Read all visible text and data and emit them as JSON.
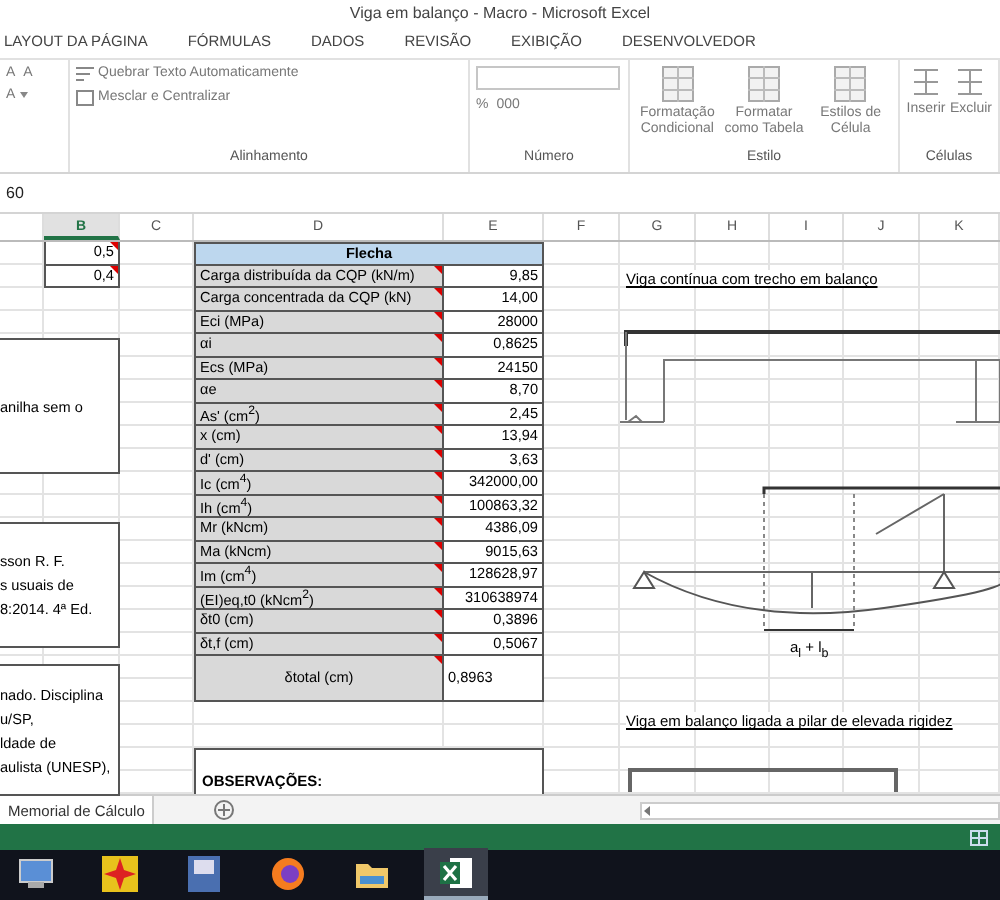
{
  "window": {
    "title": "Viga em balanço - Macro - Microsoft Excel"
  },
  "ribbon_tabs": [
    "LAYOUT DA PÁGINA",
    "FÓRMULAS",
    "DADOS",
    "REVISÃO",
    "EXIBIÇÃO",
    "DESENVOLVEDOR"
  ],
  "ribbon": {
    "font": {
      "grow": "A",
      "shrink": "A",
      "font_color_button": "A"
    },
    "alignment": {
      "wrap": "Quebrar Texto Automaticamente",
      "merge": "Mesclar e Centralizar",
      "label": "Alinhamento"
    },
    "number": {
      "percent": "%",
      "thousands": "000",
      "label": "Número"
    },
    "styles": {
      "buttons": [
        "Formatação Condicional",
        "Formatar como Tabela",
        "Estilos de Célula"
      ],
      "label": "Estilo"
    },
    "cells": {
      "buttons": [
        "Inserir",
        "Excluir"
      ],
      "label": "Células"
    }
  },
  "formula_bar": {
    "value": "60"
  },
  "columns": [
    {
      "selected": false
    },
    {
      "letter": "B",
      "selected": true
    },
    {
      "letter": "C",
      "selected": false
    },
    {
      "letter": "D",
      "selected": false
    },
    {
      "letter": "E",
      "selected": false
    },
    {
      "letter": "F",
      "selected": false
    },
    {
      "letter": "G",
      "selected": false
    },
    {
      "letter": "H",
      "selected": false
    },
    {
      "letter": "I",
      "selected": false
    },
    {
      "letter": "J",
      "selected": false
    },
    {
      "letter": "K",
      "selected": false
    }
  ],
  "b_values": [
    "0,5",
    "0,4"
  ],
  "flecha": {
    "title": "Flecha",
    "rows": [
      {
        "label": "Carga distribuída da CQP (kN/m)",
        "value": "9,85"
      },
      {
        "label": "Carga concentrada da CQP (kN)",
        "value": "14,00"
      },
      {
        "label": "Eci (MPa)",
        "value": "28000"
      },
      {
        "label": "αi",
        "value": "0,8625"
      },
      {
        "label": "Ecs (MPa)",
        "value": "24150"
      },
      {
        "label": "αe",
        "value": "8,70"
      },
      {
        "label": "As' (cm$^{2}$)",
        "value": "2,45"
      },
      {
        "label": "x (cm)",
        "value": "13,94"
      },
      {
        "label": "d' (cm)",
        "value": "3,63"
      },
      {
        "label": "Ic (cm$^{4}$)",
        "value": "342000,00"
      },
      {
        "label": "Ih (cm$^{4}$)",
        "value": "100863,32"
      },
      {
        "label": "Mr (kNcm)",
        "value": "4386,09"
      },
      {
        "label": "Ma (kNcm)",
        "value": "9015,63"
      },
      {
        "label": "Im (cm$^{4}$)",
        "value": "128628,97"
      },
      {
        "label": "(EI)eq,t0 (kNcm$^{2}$)",
        "value": "310638974"
      },
      {
        "label": "δt0 (cm)",
        "value": "0,3896"
      },
      {
        "label": "δt,f (cm)",
        "value": "0,5067"
      }
    ],
    "total": {
      "label": "δtotal (cm)",
      "value": "0,8963"
    }
  },
  "observations": "OBSERVAÇÕES:",
  "text_boxes": [
    [
      "anilha sem o"
    ],
    [
      "sson R. F.",
      "s usuais de",
      "8:2014. 4ª Ed."
    ],
    [
      "nado. Disciplina",
      "u/SP,",
      "ldade de",
      "aulista (UNESP),"
    ]
  ],
  "drawings": {
    "title_1": "Viga contínua com trecho em balanço",
    "dimension": "a$_{l}$ + l$_{b}$",
    "title_2": "Viga em balanço ligada a pilar de elevada rigidez"
  },
  "sheet_tabs": [
    {
      "label": "Memorial de Cálculo",
      "selected": true
    }
  ],
  "taskbar": [
    {
      "kind": "computer",
      "selected": false
    },
    {
      "kind": "star",
      "selected": false
    },
    {
      "kind": "disk",
      "selected": false
    },
    {
      "kind": "browser",
      "selected": false
    },
    {
      "kind": "folder",
      "selected": false
    },
    {
      "kind": "excel",
      "selected": true
    }
  ]
}
